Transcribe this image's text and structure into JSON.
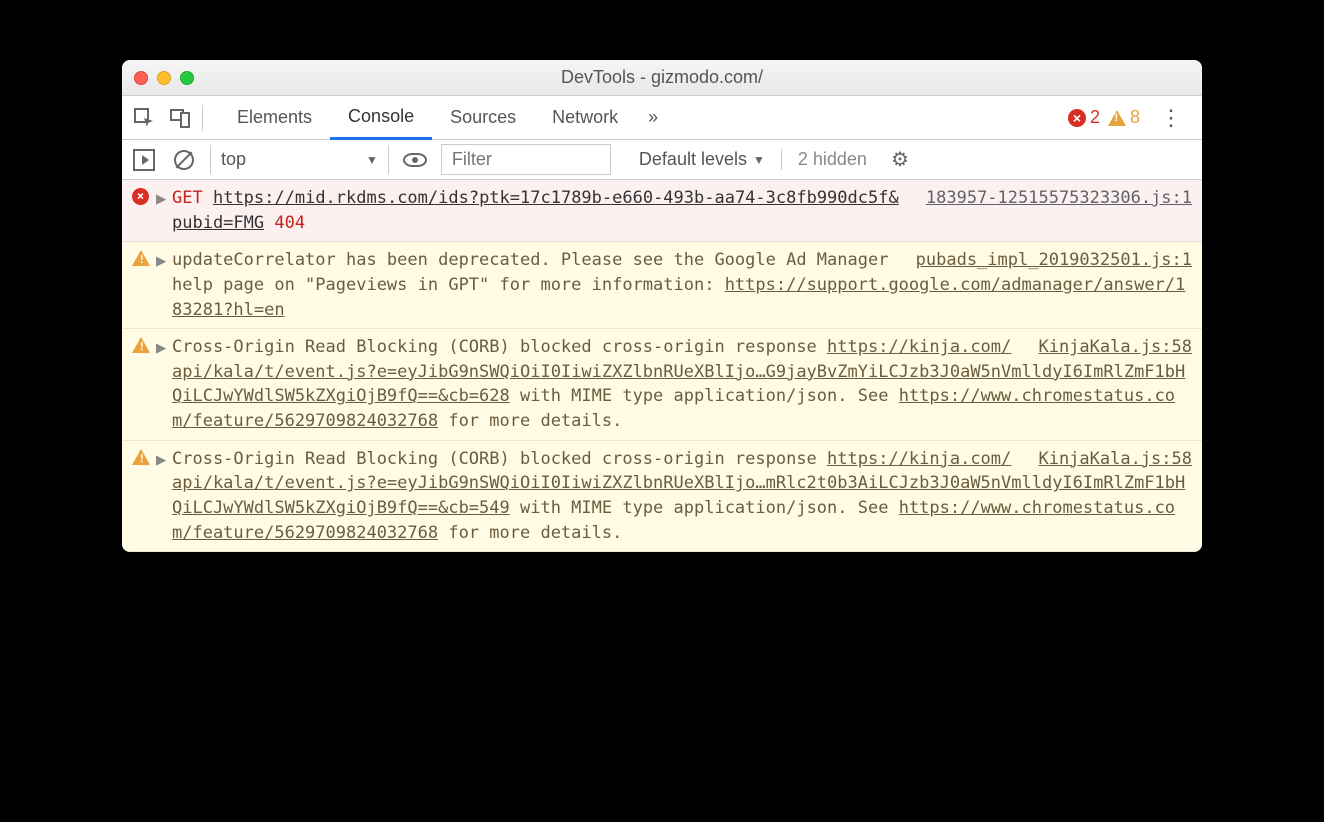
{
  "window_title": "DevTools - gizmodo.com/",
  "tabs": {
    "items": [
      "Elements",
      "Console",
      "Sources",
      "Network"
    ],
    "active_index": 1,
    "more_glyph": "»"
  },
  "badge_counts": {
    "errors": "2",
    "warnings": "8"
  },
  "filterbar": {
    "context": "top",
    "dropdown_glyph": "▼",
    "filter_placeholder": "Filter",
    "levels_label": "Default levels",
    "hidden_text": "2 hidden"
  },
  "messages": [
    {
      "type": "error",
      "source": "183957-12515575323306.js:1",
      "get_label": "GET",
      "url": "https://mid.rkdms.com/ids?ptk=17c1789b-e660-493b-aa74-3c8fb990dc5f&pubid=FMG",
      "status": "404"
    },
    {
      "type": "warn",
      "source": "pubads_impl_2019032501.js:1",
      "text_pre": "updateCorrelator has been deprecated. Please see the Google Ad Manager help page on \"Pageviews in GPT\" for more information: ",
      "link": "https://support.google.com/admanager/answer/183281?hl=en"
    },
    {
      "type": "warn",
      "source": "KinjaKala.js:58",
      "text_pre": "Cross-Origin Read Blocking (CORB) blocked cross-origin response ",
      "link": "https://kinja.com/api/kala/t/event.js?e=eyJibG9nSWQiOiI0IiwiZXZlbnRUeXBlIjo…G9jayBvZmYiLCJzb3J0aW5nVmlldyI6ImRlZmF1bHQiLCJwYWdlSW5kZXgiOjB9fQ==&cb=628",
      "text_mid": " with MIME type application/json. See ",
      "link2": "https://www.chromestatus.com/feature/5629709824032768",
      "text_post": " for more details."
    },
    {
      "type": "warn",
      "source": "KinjaKala.js:58",
      "text_pre": "Cross-Origin Read Blocking (CORB) blocked cross-origin response ",
      "link": "https://kinja.com/api/kala/t/event.js?e=eyJibG9nSWQiOiI0IiwiZXZlbnRUeXBlIjo…mRlc2t0b3AiLCJzb3J0aW5nVmlldyI6ImRlZmF1bHQiLCJwYWdlSW5kZXgiOjB9fQ==&cb=549",
      "text_mid": " with MIME type application/json. See ",
      "link2": "https://www.chromestatus.com/feature/5629709824032768",
      "text_post": " for more details."
    }
  ]
}
